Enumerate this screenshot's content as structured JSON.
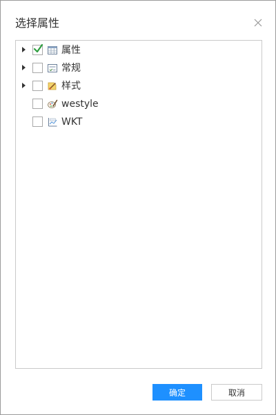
{
  "dialog": {
    "title": "选择属性",
    "close_icon": "close-icon"
  },
  "tree": {
    "items": [
      {
        "label": "属性",
        "checked": true,
        "expandable": true,
        "icon": "table-icon"
      },
      {
        "label": "常规",
        "checked": false,
        "expandable": true,
        "icon": "form-icon"
      },
      {
        "label": "样式",
        "checked": false,
        "expandable": true,
        "icon": "style-icon"
      },
      {
        "label": "westyle",
        "checked": false,
        "expandable": false,
        "icon": "brush-icon"
      },
      {
        "label": "WKT",
        "checked": false,
        "expandable": false,
        "icon": "wkt-icon"
      }
    ]
  },
  "footer": {
    "confirm_label": "确定",
    "cancel_label": "取消"
  },
  "colors": {
    "primary": "#1e90ff",
    "check": "#2e9e3f",
    "border": "#c9c9c9"
  }
}
